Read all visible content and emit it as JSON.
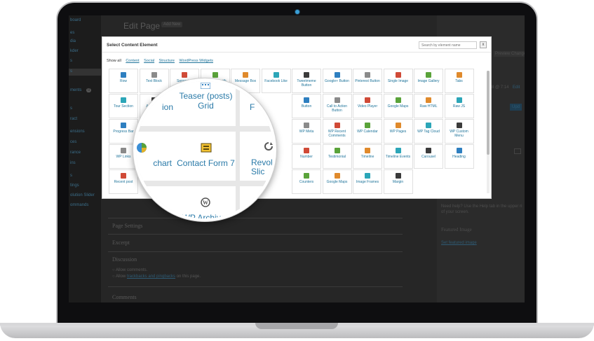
{
  "wp": {
    "page_title": "Edit Page",
    "add_new": "Add New",
    "sidebar_items": [
      "board",
      "es",
      "dia",
      "kder",
      "s",
      "s",
      "ments",
      "s",
      "ract",
      "ensions",
      "ces",
      "rance",
      "ins",
      "s",
      "tings",
      "olution Slider",
      "ommands"
    ],
    "comments_badge": "0",
    "postboxes": [
      "Page Settings",
      "Excerpt",
      "Discussion",
      "Comments"
    ],
    "discussion_allow_comments": "Allow comments.",
    "discussion_allow_trackbacks_prefix": "Allow",
    "discussion_allow_trackbacks_link": "trackbacks and pingbacks",
    "discussion_allow_trackbacks_suffix": "on this page.",
    "right": {
      "preview_changes": "Preview Change",
      "date_fragment": "2018 @ 7:14",
      "edit": "Edit",
      "update": "Upd",
      "help_text_1": "Need help? Use the Help tab in the upper ri",
      "help_text_2": "of your screen.",
      "featured_image": "Featured Image",
      "set_featured_image": "Set featured image"
    }
  },
  "modal": {
    "title": "Select Content Element",
    "search_placeholder": "Search by element name",
    "close_label": "x",
    "filters": [
      {
        "label": "Show all",
        "active": true
      },
      {
        "label": "Content",
        "active": false
      },
      {
        "label": "Social",
        "active": false
      },
      {
        "label": "Structure",
        "active": false
      },
      {
        "label": "WordPress Widgets",
        "active": false
      }
    ],
    "elements": [
      [
        "Row",
        "Text Block",
        "Separator",
        "Separator with Text",
        "Message Box",
        "Facebook Like",
        "Tweetmeme Button",
        "Google+ Button",
        "Pinterest Button",
        "Single Image",
        "Image Gallery",
        "Tabs"
      ],
      [
        "Tour Section",
        "Accordion",
        "",
        "",
        "Button",
        "Call to Action Button",
        "Video Player",
        "Google Maps",
        "Raw HTML",
        "Raw JS",
        "Flickr Widget"
      ],
      [
        "Progress Bar",
        "",
        "",
        "",
        "WP Meta",
        "WP Recent Comments",
        "WP Calendar",
        "WP Pages",
        "WP Tag Cloud",
        "WP Custom Menu",
        "WP Text"
      ],
      [
        "WP Links",
        "",
        "",
        "",
        "Number",
        "Testimonial",
        "Timeline",
        "Timeline Events",
        "Carousel",
        "Heading",
        "Countdown"
      ],
      [
        "Recent post",
        "",
        "",
        "",
        "Counters",
        "Google Maps",
        "Image Frames",
        "Margin"
      ]
    ],
    "icon_colors": {
      "blue": "#2e7fc0",
      "grey": "#8a8a8a",
      "red": "#d04a37",
      "green": "#5aa33a",
      "orange": "#e08a2c",
      "teal": "#2ca6b8",
      "dark": "#3b3b3b"
    }
  },
  "magnifier": {
    "items": [
      {
        "label": "Teaser (posts) Grid",
        "icon": "grid-icon"
      },
      {
        "label": "chart",
        "icon": "pie-chart-icon"
      },
      {
        "label": "Contact Form 7",
        "icon": "contact-form-icon"
      },
      {
        "label": "Revol Slic",
        "icon": "revolution-slider-icon"
      },
      {
        "label": "WP Archives",
        "icon": "wordpress-icon"
      },
      {
        "label": "ion",
        "icon": ""
      },
      {
        "label": "F",
        "icon": ""
      }
    ]
  }
}
